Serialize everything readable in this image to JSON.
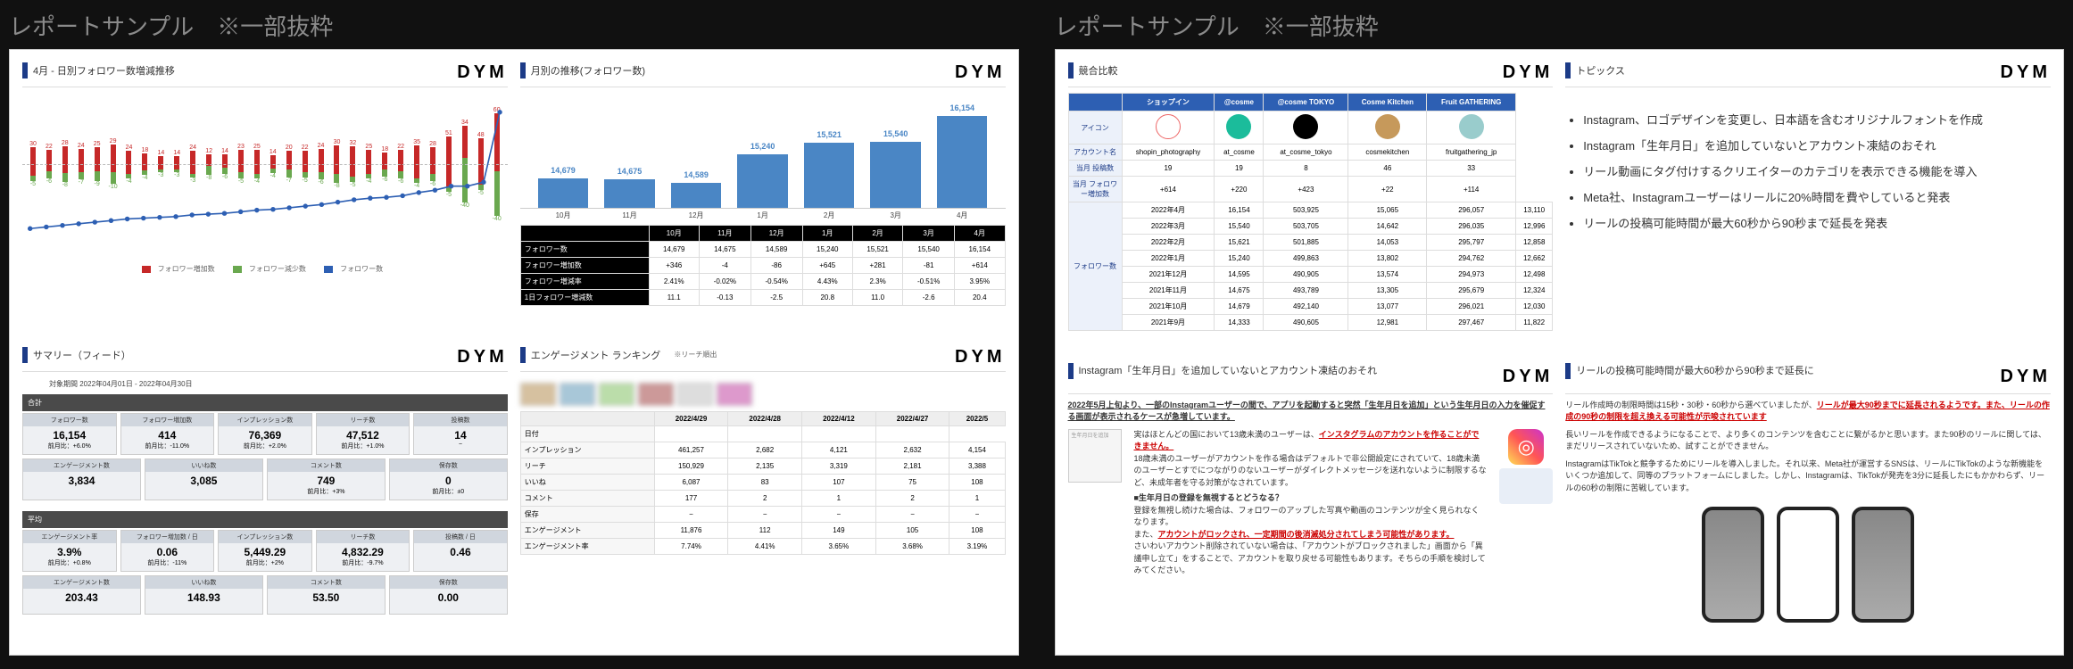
{
  "colTitle": "レポートサンプル　※一部抜粋",
  "brand": "DYM",
  "sheet1": {
    "p1": {
      "title": "4月 - 日別フォロワー数増減推移",
      "legend": {
        "a": "フォロワー増加数",
        "b": "フォロワー減少数",
        "c": "フォロワー数"
      }
    },
    "p2": {
      "title": "サマリー（フィード）",
      "periodLabel": "対象期間",
      "period": "2022年04月01日 - 2022年04月30日",
      "avgLabel": "平均",
      "block1": [
        {
          "name": "フォロワー数",
          "val": "16,154",
          "sub": "前月比：+6.0%",
          "cls": "up"
        },
        {
          "name": "フォロワー増加数",
          "val": "414",
          "sub": "前月比：-11.0%",
          "cls": "dn"
        },
        {
          "name": "インプレッション数",
          "val": "76,369",
          "sub": "前月比：+2.0%",
          "cls": "up"
        },
        {
          "name": "リーチ数",
          "val": "47,512",
          "sub": "前月比：+1.0%",
          "cls": "up"
        },
        {
          "name": "投稿数",
          "val": "14",
          "sub": "−"
        }
      ],
      "block2": [
        {
          "name": "エンゲージメント数",
          "val": "3,834",
          "sub": ""
        },
        {
          "name": "いいね数",
          "val": "3,085",
          "sub": ""
        },
        {
          "name": "コメント数",
          "val": "749",
          "sub": "前月比：+3%",
          "cls": "up"
        },
        {
          "name": "保存数",
          "val": "0",
          "sub": "前月比：±0"
        }
      ],
      "block3": [
        {
          "name": "エンゲージメント率",
          "val": "3.9%",
          "sub": "前月比：+0.8%",
          "cls": "up"
        },
        {
          "name": "フォロワー増加数 / 日",
          "val": "0.06",
          "sub": "前月比：-11%",
          "cls": "dn"
        },
        {
          "name": "インプレッション数",
          "val": "5,449.29",
          "sub": "前月比：+2%",
          "cls": "up"
        },
        {
          "name": "リーチ数",
          "val": "4,832.29",
          "sub": "前月比：-9.7%",
          "cls": "dn"
        },
        {
          "name": "投稿数 / 日",
          "val": "0.46",
          "sub": ""
        }
      ],
      "block4": [
        {
          "name": "エンゲージメント数",
          "val": "203.43",
          "sub": ""
        },
        {
          "name": "いいね数",
          "val": "148.93",
          "sub": ""
        },
        {
          "name": "コメント数",
          "val": "53.50",
          "sub": ""
        },
        {
          "name": "保存数",
          "val": "0.00",
          "sub": ""
        }
      ]
    },
    "p3": {
      "title": "月別の推移(フォロワー数)",
      "table": {
        "cols": [
          "",
          "10月",
          "11月",
          "12月",
          "1月",
          "2月",
          "3月",
          "4月"
        ],
        "rows": [
          [
            "フォロワー数",
            "14,679",
            "14,675",
            "14,589",
            "15,240",
            "15,521",
            "15,540",
            "16,154"
          ],
          [
            "フォロワー増加数",
            "+346",
            "-4",
            "-86",
            "+645",
            "+281",
            "-81",
            "+614"
          ],
          [
            "フォロワー増減率",
            "2.41%",
            "-0.02%",
            "-0.54%",
            "4.43%",
            "2.3%",
            "-0.51%",
            "3.95%"
          ],
          [
            "1日フォロワー増減数",
            "11.1",
            "-0.13",
            "-2.5",
            "20.8",
            "11.0",
            "-2.6",
            "20.4"
          ]
        ]
      }
    },
    "p4": {
      "title": "エンゲージメント ランキング",
      "note": "※リーチ順出",
      "cols": [
        "",
        "2022/4/29",
        "2022/4/28",
        "2022/4/12",
        "2022/4/27",
        "2022/5"
      ],
      "rows": [
        [
          "日付",
          "",
          "",
          "",
          ""
        ],
        [
          "インプレッション",
          "461,257",
          "2,682",
          "4,121",
          "2,632",
          "4,154"
        ],
        [
          "リーチ",
          "150,929",
          "2,135",
          "3,319",
          "2,181",
          "3,388"
        ],
        [
          "いいね",
          "6,087",
          "83",
          "107",
          "75",
          "108"
        ],
        [
          "コメント",
          "177",
          "2",
          "1",
          "2",
          "1"
        ],
        [
          "保存",
          "−",
          "−",
          "−",
          "−",
          "−"
        ],
        [
          "エンゲージメント",
          "11,876",
          "112",
          "149",
          "105",
          "108"
        ],
        [
          "エンゲージメント率",
          "7.74%",
          "4.41%",
          "3.65%",
          "3.68%",
          "3.19%"
        ]
      ]
    }
  },
  "sheet2": {
    "p1": {
      "title": "競合比較",
      "cols": [
        "",
        "ショップイン",
        "@cosme",
        "@cosme TOKYO",
        "Cosme Kitchen",
        "Fruit GATHERING"
      ],
      "rowHeads": [
        "アイコン",
        "アカウント名",
        "当月 投稿数",
        "当月 フォロワー増加数"
      ],
      "acc": [
        "shopin_photography",
        "at_cosme",
        "at_cosme_tokyo",
        "cosmekitchen",
        "fruitgathering_jp"
      ],
      "posts": [
        "19",
        "19",
        "8",
        "46",
        "33"
      ],
      "finc": [
        "+614",
        "+220",
        "+423",
        "+22",
        "+114"
      ],
      "followerLabel": "フォロワー数",
      "followers": [
        [
          "2022年4月",
          "16,154",
          "503,925",
          "15,065",
          "296,057",
          "13,110"
        ],
        [
          "2022年3月",
          "15,540",
          "503,705",
          "14,642",
          "296,035",
          "12,996"
        ],
        [
          "2022年2月",
          "15,621",
          "501,885",
          "14,053",
          "295,797",
          "12,858"
        ],
        [
          "2022年1月",
          "15,240",
          "499,863",
          "13,802",
          "294,762",
          "12,662"
        ],
        [
          "2021年12月",
          "14,595",
          "490,905",
          "13,574",
          "294,973",
          "12,498"
        ],
        [
          "2021年11月",
          "14,675",
          "493,789",
          "13,305",
          "295,679",
          "12,324"
        ],
        [
          "2021年10月",
          "14,679",
          "492,140",
          "13,077",
          "296,021",
          "12,030"
        ],
        [
          "2021年9月",
          "14,333",
          "490,605",
          "12,981",
          "297,467",
          "11,822"
        ]
      ]
    },
    "p2": {
      "title": "トピックス",
      "items": [
        "Instagram、ロゴデザインを変更し、日本語を含むオリジナルフォントを作成",
        "Instagram「生年月日」を追加していないとアカウント凍結のおそれ",
        "リール動画にタグ付けするクリエイターのカテゴリを表示できる機能を導入",
        "Meta社、Instagramユーザーはリールに20%時間を費やしていると発表",
        "リールの投稿可能時間が最大60秒から90秒まで延長を発表"
      ]
    },
    "p3": {
      "title": "Instagram「生年月日」を追加していないとアカウント凍結のおそれ",
      "lead": "2022年5月上旬より、一部のInstagramユーザーの間で、アプリを起動すると突然「生年月日を追加」という生年月日の入力を催促する画面が表示されるケースが急増しています。",
      "b1a": "実はほとんどの国において13歳未満のユーザーは、",
      "b1b": "インスタグラムのアカウントを作ることができません。",
      "b2": "18歳未満のユーザーがアカウントを作る場合はデフォルトで非公開設定にされていて、18歳未満のユーザーとすでにつながりのないユーザーがダイレクトメッセージを送れないように制限するなど、未成年者を守る対策がなされています。",
      "q": "■生年月日の登録を無視するとどうなる？",
      "b3": "登録を無視し続けた場合は、フォロワーのアップした写真や動画のコンテンツが全く見られなくなります。",
      "b4a": "また、",
      "b4b": "アカウントがロックされ、一定期間の後消滅処分されてしまう可能性があります。",
      "b5": "さいわいアカウント削除されていない場合は、「アカウントがブロックされました」画面から「異議申し立て」をすることで、アカウントを取り戻せる可能性もあります。そちらの手順を検討してみてください。"
    },
    "p4": {
      "title": "リールの投稿可能時間が最大60秒から90秒まで延長に",
      "l1a": "リール作成時の制限時間は15秒・30秒・60秒から選べていましたが、",
      "l1b": "リールが最大90秒までに延長されるようです。また、リールの作成の90秒の制限を超え換える可能性が示唆されています",
      "l2": "長いリールを作成できるようになることで、より多くのコンテンツを含むことに繋がるかと思います。また90秒のリールに関しては、まだリリースされていないため、試すことができません。",
      "l3": "InstagramはTikTokと競争するためにリールを導入しました。それ以来、Meta社が運営するSNSは、リールにTikTokのような新機能をいくつか追加して、同等のプラットフォームにしました。しかし、Instagramは、TikTokが発売を3分に延長したにもかかわらず、リールの60秒の制限に苦戦しています。"
    }
  },
  "chart_data": [
    {
      "type": "bar",
      "title": "4月 - 日別フォロワー数増減推移",
      "series": [
        {
          "name": "フォロワー増加数",
          "values": [
            30,
            22,
            28,
            24,
            25,
            29,
            24,
            18,
            14,
            14,
            24,
            12,
            14,
            23,
            25,
            14,
            20,
            22,
            24,
            30,
            32,
            25,
            18,
            22,
            35,
            28,
            51,
            34,
            48,
            60
          ]
        },
        {
          "name": "フォロワー減少数",
          "values": [
            -5,
            -6,
            -8,
            -7,
            -9,
            -10,
            -4,
            -4,
            -3,
            -3,
            -3,
            -8,
            -6,
            -5,
            -4,
            -4,
            -7,
            -5,
            -6,
            -8,
            -5,
            -4,
            -6,
            -6,
            -4,
            -6,
            -5,
            -40,
            -5,
            -40
          ]
        },
        {
          "name": "フォロワー数",
          "values": [
            14700,
            14720,
            14740,
            14760,
            14780,
            14800,
            14820,
            14830,
            14840,
            14850,
            14870,
            14880,
            14890,
            14910,
            14930,
            14940,
            14960,
            14980,
            15000,
            15030,
            15060,
            15080,
            15090,
            15110,
            15150,
            15180,
            15230,
            15230,
            15280,
            16154
          ]
        }
      ],
      "x": [
        1,
        2,
        3,
        4,
        5,
        6,
        7,
        8,
        9,
        10,
        11,
        12,
        13,
        14,
        15,
        16,
        17,
        18,
        19,
        20,
        21,
        22,
        23,
        24,
        25,
        26,
        27,
        28,
        29,
        30
      ]
    },
    {
      "type": "bar",
      "title": "月別の推移(フォロワー数)",
      "categories": [
        "10月",
        "11月",
        "12月",
        "1月",
        "2月",
        "3月",
        "4月"
      ],
      "values": [
        14679,
        14675,
        14589,
        15240,
        15521,
        15540,
        16154
      ],
      "ylim": [
        14000,
        16500
      ]
    }
  ]
}
